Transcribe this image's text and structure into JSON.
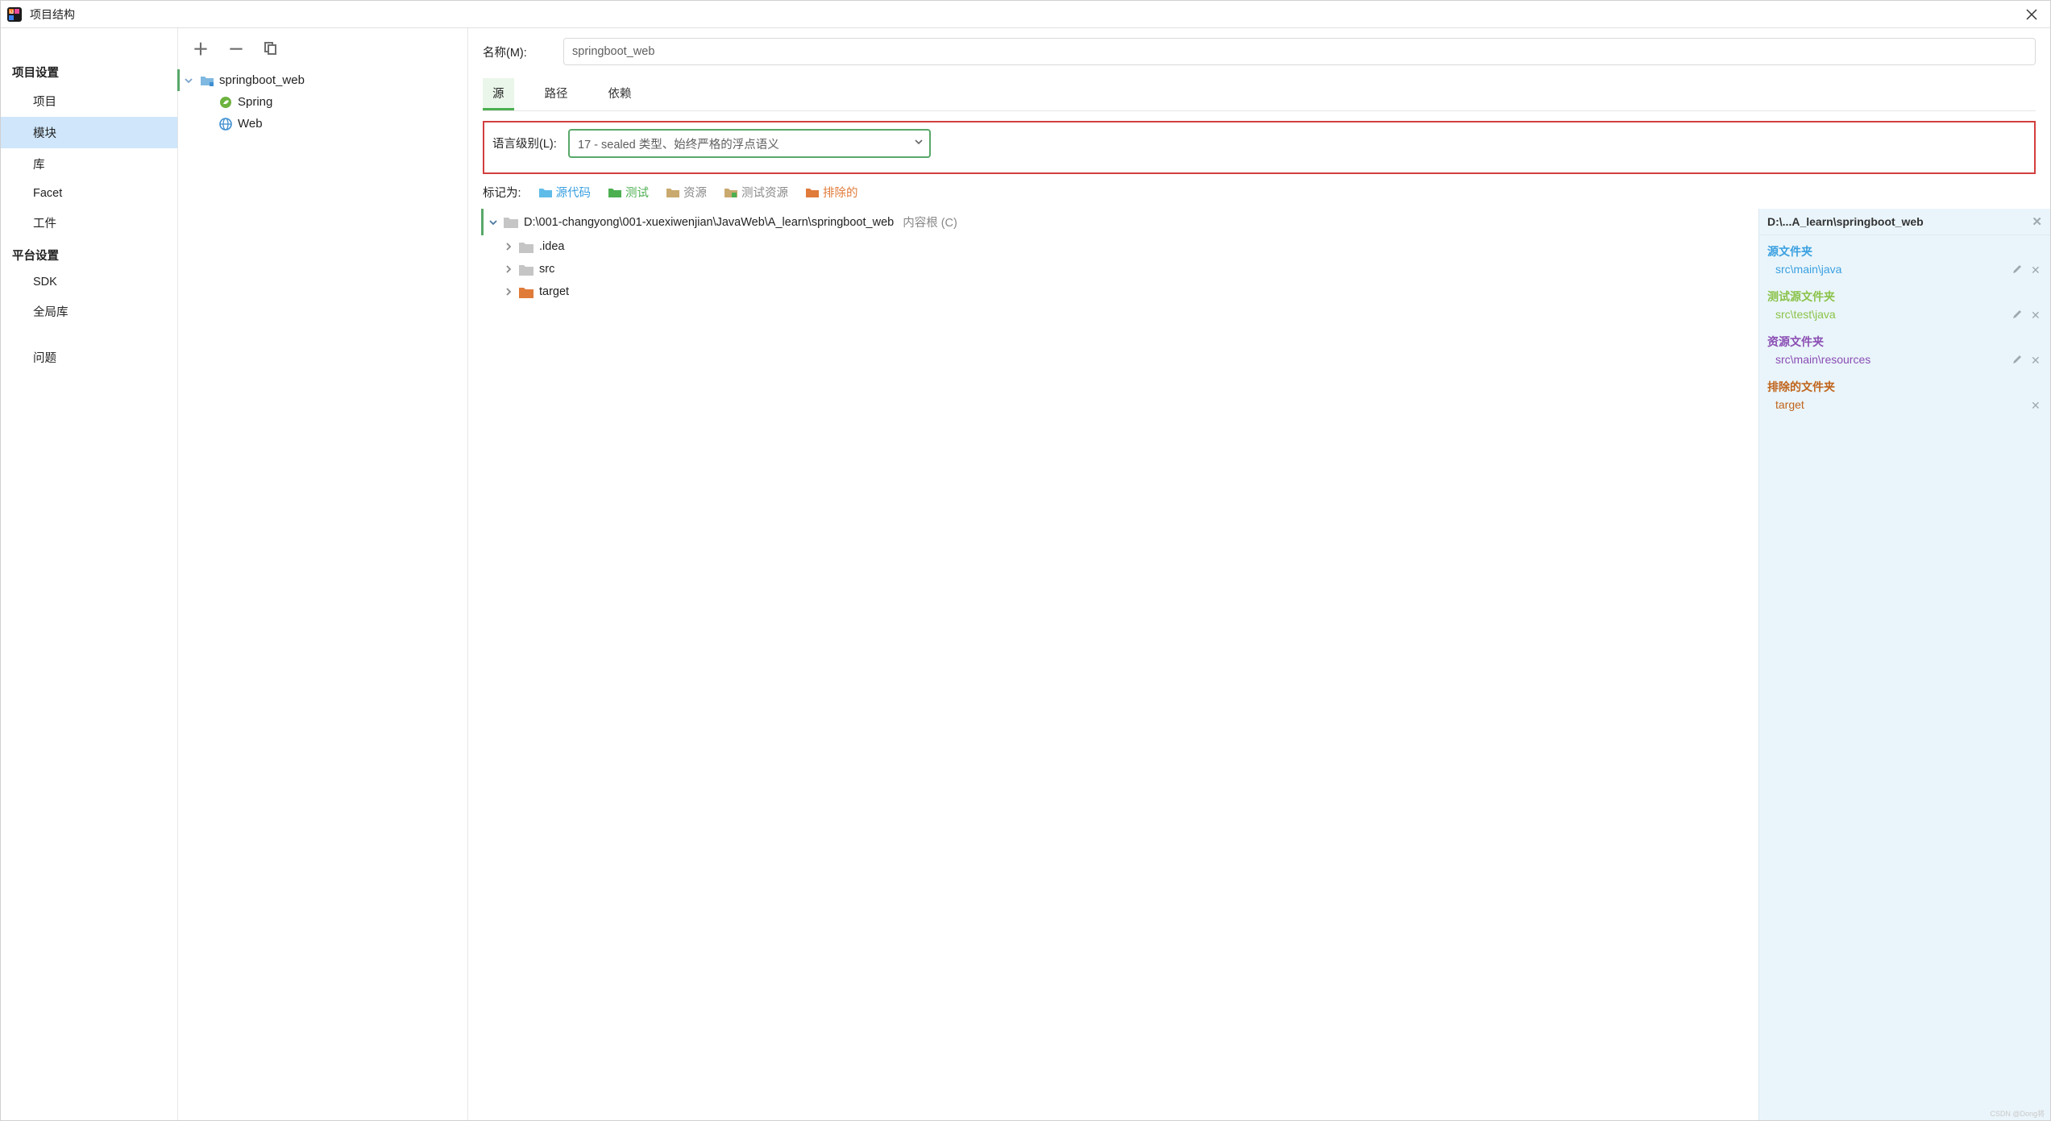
{
  "titlebar": {
    "title": "项目结构"
  },
  "sidebar": {
    "section1": "项目设置",
    "items1": [
      "项目",
      "模块",
      "库",
      "Facet",
      "工件"
    ],
    "section2": "平台设置",
    "items2": [
      "SDK",
      "全局库"
    ],
    "section3_item": "问题"
  },
  "modtree": {
    "root": "springboot_web",
    "children": [
      "Spring",
      "Web"
    ]
  },
  "detail": {
    "name_label": "名称(M):",
    "name_value": "springboot_web",
    "tabs": [
      "源",
      "路径",
      "依赖"
    ],
    "lang_label": "语言级别(L):",
    "lang_value": "17 - sealed 类型、始终严格的浮点语义",
    "mark_label": "标记为:",
    "marks": [
      "源代码",
      "测试",
      "资源",
      "测试资源",
      "排除的"
    ],
    "root_path": "D:\\001-changyong\\001-xuexiwenjian\\JavaWeb\\A_learn\\springboot_web",
    "root_suffix": "内容根 (C)",
    "children": [
      {
        "name": ".idea",
        "color": "gray"
      },
      {
        "name": "src",
        "color": "gray"
      },
      {
        "name": "target",
        "color": "orange"
      }
    ],
    "sidepanel": {
      "header": "D:\\...A_learn\\springboot_web",
      "groups": [
        {
          "title": "源文件夹",
          "color": "c-blue",
          "path": "src\\main\\java",
          "pcolor": "blue",
          "editable": true
        },
        {
          "title": "测试源文件夹",
          "color": "c-green",
          "path": "src\\test\\java",
          "pcolor": "green",
          "editable": true
        },
        {
          "title": "资源文件夹",
          "color": "c-purple",
          "path": "src\\main\\resources",
          "pcolor": "purple",
          "editable": true
        },
        {
          "title": "排除的文件夹",
          "color": "c-orange",
          "path": "target",
          "pcolor": "orange",
          "editable": false
        }
      ]
    }
  },
  "watermark": "CSDN @Dong将"
}
